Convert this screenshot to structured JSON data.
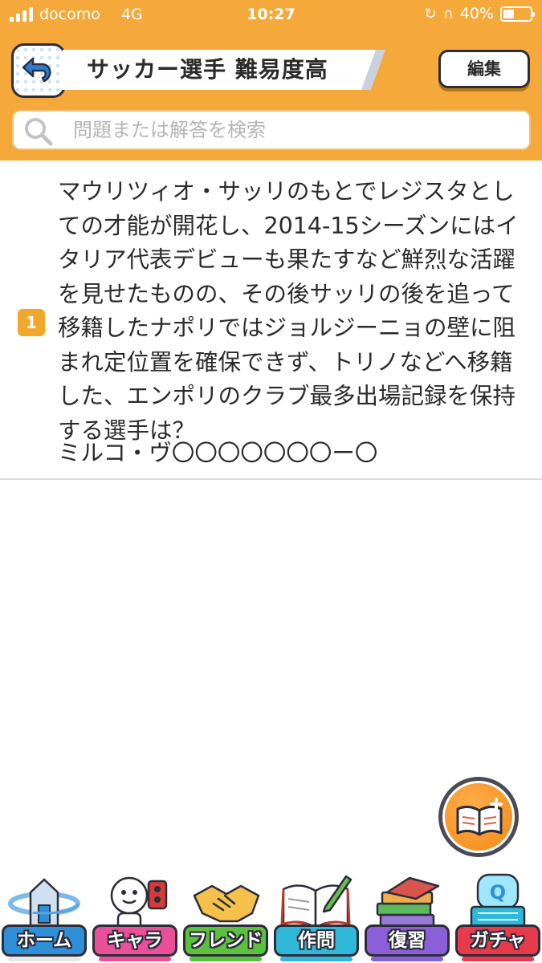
{
  "status_bar": {
    "carrier": "docomo",
    "network": "4G",
    "time": "10:27",
    "battery": "40%",
    "battery_level": 0.4
  },
  "header": {
    "title": "サッカー選手 難易度高",
    "edit_label": "編集",
    "back_icon": "back-arrow-icon"
  },
  "search": {
    "placeholder": "問題または解答を検索",
    "value": ""
  },
  "questions": [
    {
      "number": "1",
      "text": "マウリツィオ・サッリのもとでレジスタとしての才能が開花し、2014-15シーズンにはイタリア代表デビューも果たすなど鮮烈な活躍を見せたものの、その後サッリの後を追って移籍したナポリではジョルジーニョの壁に阻まれ定位置を確保できず、トリノなどへ移籍した、エンポリのクラブ最多出場記録を保持する選手は？",
      "answer": "ミルコ・ヴ〇〇〇〇〇〇〇ー〇"
    }
  ],
  "fab": {
    "icon": "book-plus-icon"
  },
  "tabs": [
    {
      "label": "ホーム",
      "icon": "home-icon",
      "color": "#2f8fd8",
      "underline": "#e8e8e8"
    },
    {
      "label": "キャラ",
      "icon": "character-icon",
      "color": "#ea4f9a",
      "underline": "#ea4f9a"
    },
    {
      "label": "フレンド",
      "icon": "handshake-icon",
      "color": "#5cc23e",
      "underline": "#5cc23e"
    },
    {
      "label": "作問",
      "icon": "notebook-pen-icon",
      "color": "#2fb8d8",
      "underline": "#2fb8d8"
    },
    {
      "label": "復習",
      "icon": "book-stack-icon",
      "color": "#8a5fd8",
      "underline": "#8a5fd8"
    },
    {
      "label": "ガチャ",
      "icon": "gacha-machine-icon",
      "color": "#e83a4a",
      "underline": "#e83a4a"
    }
  ],
  "colors": {
    "header_bg": "#f5a93b",
    "badge": "#f2a82c",
    "back_arrow": "#2a7fd4"
  }
}
